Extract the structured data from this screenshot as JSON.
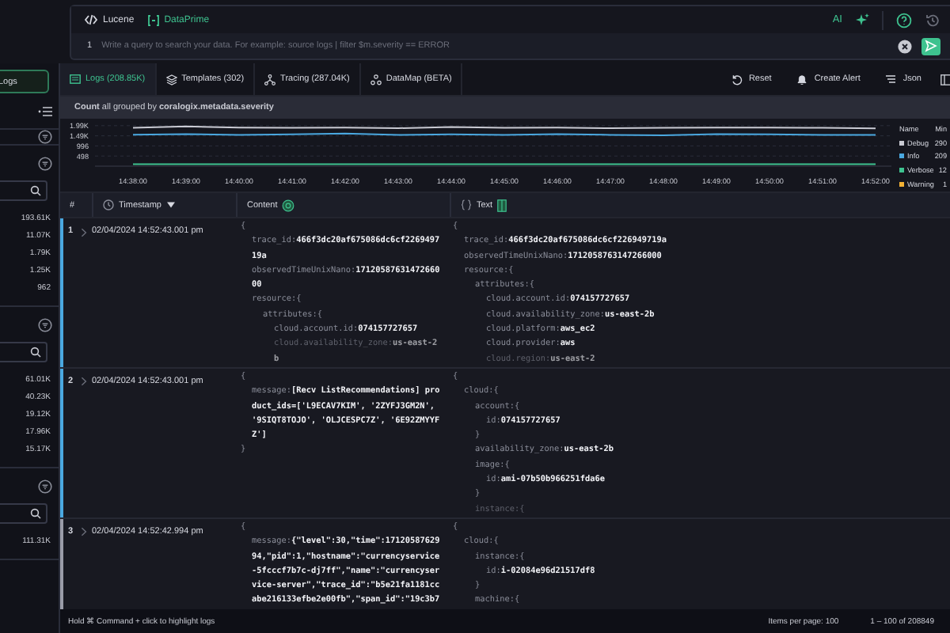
{
  "query": {
    "modes": [
      {
        "label": "Lucene",
        "kind": "code",
        "selected": false
      },
      {
        "label": "DataPrime",
        "kind": "dataprime",
        "selected": true
      }
    ],
    "ai_label": "AI",
    "line_number": "1",
    "placeholder": "Write a query to search your data. For example: source logs | filter $m.severity == ERROR"
  },
  "sidebar": {
    "logs_button": "Logs",
    "sections": [
      {
        "kind": "collapsed"
      },
      {
        "kind": "facet",
        "counts": [
          "193.61K",
          "11.07K",
          "1.79K",
          "1.25K",
          "962"
        ]
      },
      {
        "kind": "facet",
        "counts": [
          "61.01K",
          "40.23K",
          "19.12K",
          "17.96K",
          "15.17K"
        ]
      },
      {
        "kind": "facet",
        "counts": [
          "111.31K"
        ]
      }
    ]
  },
  "tabs": [
    {
      "label": "Logs (208.85K)",
      "kind": "logs",
      "selected": true
    },
    {
      "label": "Templates (302)",
      "kind": "templates",
      "selected": false
    },
    {
      "label": "Tracing (287.04K)",
      "kind": "tracing",
      "selected": false
    },
    {
      "label": "DataMap (BETA)",
      "kind": "datamap",
      "selected": false
    }
  ],
  "actions": [
    {
      "label": "Reset",
      "kind": "reset"
    },
    {
      "label": "Create Alert",
      "kind": "alert"
    },
    {
      "label": "Json",
      "kind": "json"
    }
  ],
  "chart": {
    "title": "**Count** all grouped by **coralogix.metadata.severity**",
    "legend": {
      "name_header": "Name",
      "min_header": "Min",
      "mins": [
        "290",
        "209",
        "12",
        "1"
      ]
    },
    "chart_data": {
      "type": "line",
      "categories": [
        "14:38:00",
        "14:39:00",
        "14:40:00",
        "14:41:00",
        "14:42:00",
        "14:43:00",
        "14:44:00",
        "14:45:00",
        "14:46:00",
        "14:47:00",
        "14:48:00",
        "14:49:00",
        "14:50:00",
        "14:51:00",
        "14:52:00"
      ],
      "ylim": [
        0,
        2100
      ],
      "grid": true,
      "yticks": [
        {
          "value": 498,
          "label": "498"
        },
        {
          "value": 996,
          "label": "996"
        },
        {
          "value": 1490,
          "label": "1.49K"
        },
        {
          "value": 1990,
          "label": "1.99K"
        }
      ],
      "series": [
        {
          "name": "Debug",
          "color": "#c9cad3",
          "values": [
            1880,
            1950,
            1900,
            1880,
            1900,
            1870,
            1920,
            1880,
            1900,
            1870,
            1880,
            1900,
            1900,
            1880,
            1860
          ]
        },
        {
          "name": "Info",
          "color": "#4aa8e0",
          "values": [
            1550,
            1580,
            1540,
            1560,
            1600,
            1530,
            1560,
            1540,
            1570,
            1540,
            1520,
            1580,
            1560,
            1540,
            1530
          ]
        },
        {
          "name": "Verbose",
          "color": "#3ec28f",
          "values": [
            100,
            100,
            100,
            100,
            100,
            100,
            100,
            100,
            100,
            100,
            100,
            100,
            100,
            100,
            100
          ]
        },
        {
          "name": "Warning",
          "color": "#f2b134",
          "values": [
            null,
            null,
            null,
            null,
            null,
            null,
            null,
            null,
            null,
            null,
            null,
            null,
            null,
            null,
            null
          ]
        }
      ]
    }
  },
  "table": {
    "columns": [
      {
        "label": "#",
        "kind": "index"
      },
      {
        "label": "Timestamp",
        "kind": "timestamp"
      },
      {
        "label": "Content",
        "kind": "content"
      },
      {
        "label": "Text",
        "kind": "text"
      }
    ],
    "rows": [
      {
        "number": "1",
        "timestamp": "02/04/2024 14:52:43.001 pm",
        "color": "#4aa8e0",
        "content": {
          "open": "{",
          "faded": true,
          "lines": [
            {
              "key": "trace_id:",
              "value": "466f3dc20af675086dc6cf226949719a"
            },
            {
              "key": "observedTimeUnixNano:",
              "value": "1712058763147266000"
            },
            {
              "key": "resource:{",
              "children": [
                {
                  "key": "attributes:{",
                  "children": [
                    {
                      "key": "cloud.account.id:",
                      "value": "074157727657"
                    },
                    {
                      "key": "cloud.availability_zone:",
                      "value": "us-east-2b"
                    }
                  ]
                }
              ]
            }
          ]
        },
        "text": {
          "open": "{",
          "faded": true,
          "lines": [
            {
              "key": "trace_id:",
              "value": "466f3dc20af675086dc6cf226949719a"
            },
            {
              "key": "observedTimeUnixNano:",
              "value": "1712058763147266000"
            },
            {
              "key": "resource:{",
              "children": [
                {
                  "key": "attributes:{",
                  "children": [
                    {
                      "key": "cloud.account.id:",
                      "value": "074157727657"
                    },
                    {
                      "key": "cloud.availability_zone:",
                      "value": "us-east-2b"
                    },
                    {
                      "key": "cloud.platform:",
                      "value": "aws_ec2"
                    },
                    {
                      "key": "cloud.provider:",
                      "value": "aws"
                    },
                    {
                      "key": "cloud.region:",
                      "value": "us-east-2"
                    }
                  ]
                }
              ]
            }
          ]
        }
      },
      {
        "number": "2",
        "timestamp": "02/04/2024 14:52:43.001 pm",
        "color": "#4aa8e0",
        "content": {
          "open": "{",
          "close": "}",
          "faded": false,
          "lines": [
            {
              "key": "message:",
              "value": "[Recv ListRecommendations] product_ids=['L9ECAV7KIM', '2ZYFJ3GM2N', '9SIQT8TOJO', 'OLJCESPC7Z', '6E92ZMYYFZ']"
            }
          ]
        },
        "text": {
          "open": "{",
          "faded": true,
          "lines": [
            {
              "key": "cloud:{",
              "children": [
                {
                  "key": "account:{",
                  "close": "}",
                  "children": [
                    {
                      "key": "id:",
                      "value": "074157727657"
                    }
                  ]
                },
                {
                  "key": "availability_zone:",
                  "value": "us-east-2b"
                },
                {
                  "key": "image:{",
                  "close": "}",
                  "children": [
                    {
                      "key": "id:",
                      "value": "ami-07b50b966251fda6e"
                    }
                  ]
                },
                {
                  "key": "instance:{"
                }
              ]
            }
          ]
        }
      },
      {
        "number": "3",
        "timestamp": "02/04/2024 14:52:42.994 pm",
        "color": "#9a9ca8",
        "content": {
          "open": "{",
          "faded": false,
          "lines": [
            {
              "key": "message:",
              "value": "{\"level\":30,\"time\":1712058762994,\"pid\":1,\"hostname\":\"currencyservice-5fcccf7b7c-dj7ff\",\"name\":\"currencyservice-server\",\"trace_id\":\"b5e21fa1181ccabe216133efbe2e00fb\",\"span_id\":\"19c3b7"
            }
          ]
        },
        "text": {
          "open": "{",
          "faded": false,
          "lines": [
            {
              "key": "cloud:{",
              "children": [
                {
                  "key": "instance:{",
                  "close": "}",
                  "children": [
                    {
                      "key": "id:",
                      "value": "i-02084e96d21517df8"
                    }
                  ]
                },
                {
                  "key": "machine:{"
                }
              ]
            }
          ]
        }
      }
    ]
  },
  "footer": {
    "hint": "Hold ⌘ Command + click to highlight logs",
    "page_size": "Items per page: 100",
    "range": "1 – 100 of 208849"
  }
}
